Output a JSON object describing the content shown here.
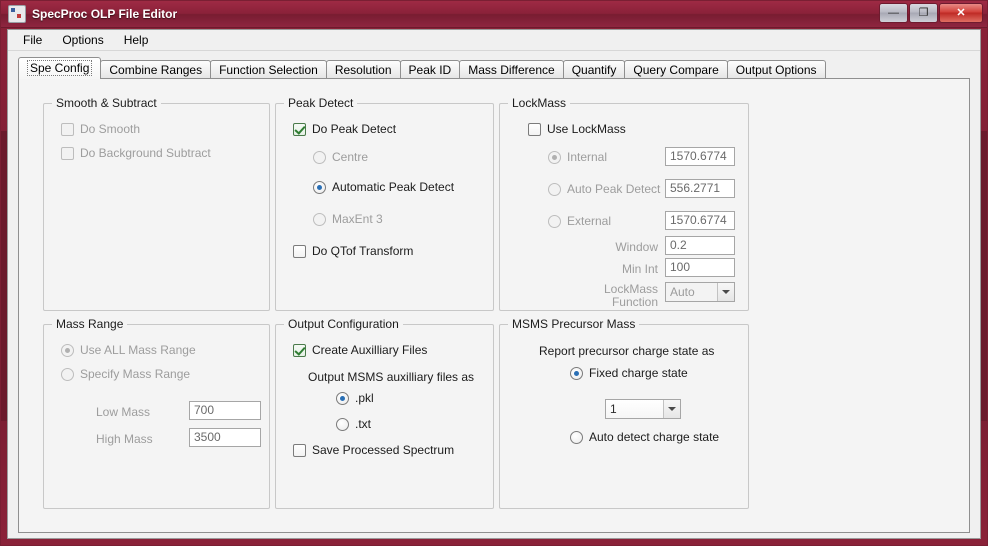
{
  "window": {
    "title": "SpecProc OLP File Editor",
    "buttons": {
      "minimize": "—",
      "maximize": "❐",
      "close": "✕"
    }
  },
  "menubar": {
    "items": [
      {
        "label": "File"
      },
      {
        "label": "Options"
      },
      {
        "label": "Help"
      }
    ]
  },
  "tabs": [
    {
      "label": "Spe Config",
      "active": true
    },
    {
      "label": "Combine Ranges",
      "active": false
    },
    {
      "label": "Function Selection",
      "active": false
    },
    {
      "label": "Resolution",
      "active": false
    },
    {
      "label": "Peak ID",
      "active": false
    },
    {
      "label": "Mass Difference",
      "active": false
    },
    {
      "label": "Quantify",
      "active": false
    },
    {
      "label": "Query Compare",
      "active": false
    },
    {
      "label": "Output Options",
      "active": false
    }
  ],
  "smooth_subtract": {
    "title": "Smooth & Subtract",
    "do_smooth": "Do Smooth",
    "do_background_subtract": "Do Background Subtract"
  },
  "peak_detect": {
    "title": "Peak Detect",
    "do_peak_detect": "Do Peak Detect",
    "centre": "Centre",
    "automatic_peak_detect": "Automatic Peak Detect",
    "maxent3": "MaxEnt 3",
    "do_qtof_transform": "Do QTof Transform"
  },
  "lockmass": {
    "title": "LockMass",
    "use_lockmass": "Use LockMass",
    "internal": "Internal",
    "internal_value": "1570.6774",
    "auto_peak_detect": "Auto Peak Detect",
    "auto_peak_detect_value": "556.2771",
    "external": "External",
    "external_value": "1570.6774",
    "window_label": "Window",
    "window_value": "0.2",
    "min_int_label": "Min Int",
    "min_int_value": "100",
    "function_label_line1": "LockMass",
    "function_label_line2": "Function",
    "function_value": "Auto"
  },
  "mass_range": {
    "title": "Mass Range",
    "use_all": "Use ALL Mass Range",
    "specify": "Specify Mass Range",
    "low_mass_label": "Low Mass",
    "low_mass_value": "700",
    "high_mass_label": "High Mass",
    "high_mass_value": "3500"
  },
  "output_configuration": {
    "title": "Output Configuration",
    "create_auxiliary_files": "Create Auxilliary Files",
    "output_as_label": "Output MSMS auxilliary files as",
    "pkl": ".pkl",
    "txt": ".txt",
    "save_processed_spectrum": "Save Processed Spectrum"
  },
  "msms_precursor_mass": {
    "title": "MSMS Precursor Mass",
    "report_label": "Report precursor charge state as",
    "fixed_charge_state": "Fixed charge state",
    "fixed_charge_value": "1",
    "auto_detect": "Auto detect charge state"
  },
  "colors": {
    "frame": "#8b2239",
    "accent_blue": "#2a6fb5",
    "check_green": "#2f7d32"
  }
}
